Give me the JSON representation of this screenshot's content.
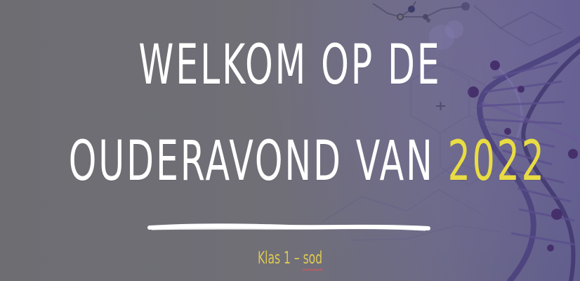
{
  "slide": {
    "title_line1": "WELKOM OP DE",
    "title_line2_main": "OUDERAVOND  VAN ",
    "title_line2_year": "2022",
    "subtitle_prefix": "Klas 1 – ",
    "subtitle_flagged": "sod"
  },
  "colors": {
    "background": "#6f6e75",
    "title": "#ffffff",
    "year": "#e9dc43",
    "subtitle": "#ddc955",
    "spellcheck": "#e05757"
  }
}
